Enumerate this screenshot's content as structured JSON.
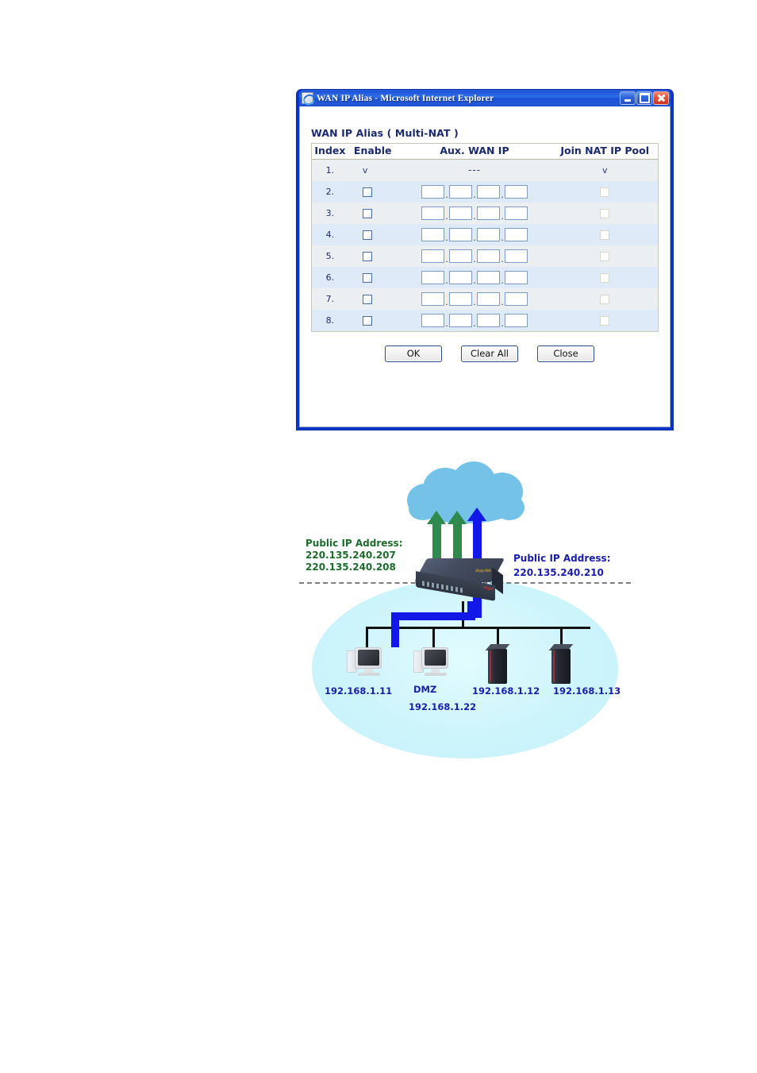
{
  "window": {
    "title": "WAN IP Alias - Microsoft Internet Explorer",
    "icon": "ie-page-icon",
    "minimize_label": "Minimize",
    "maximize_label": "Maximize",
    "close_label": "Close"
  },
  "page": {
    "heading": "WAN IP Alias ( Multi-NAT )",
    "columns": [
      "Index",
      "Enable",
      "Aux. WAN IP",
      "Join NAT IP Pool"
    ],
    "rows": [
      {
        "index": "1.",
        "enable": "v",
        "ip": "---",
        "pool": "v",
        "editable": false
      },
      {
        "index": "2.",
        "enable": "",
        "ip": [
          "",
          "",
          "",
          ""
        ],
        "pool": "",
        "editable": true
      },
      {
        "index": "3.",
        "enable": "",
        "ip": [
          "",
          "",
          "",
          ""
        ],
        "pool": "",
        "editable": true
      },
      {
        "index": "4.",
        "enable": "",
        "ip": [
          "",
          "",
          "",
          ""
        ],
        "pool": "",
        "editable": true
      },
      {
        "index": "5.",
        "enable": "",
        "ip": [
          "",
          "",
          "",
          ""
        ],
        "pool": "",
        "editable": true
      },
      {
        "index": "6.",
        "enable": "",
        "ip": [
          "",
          "",
          "",
          ""
        ],
        "pool": "",
        "editable": true
      },
      {
        "index": "7.",
        "enable": "",
        "ip": [
          "",
          "",
          "",
          ""
        ],
        "pool": "",
        "editable": true
      },
      {
        "index": "8.",
        "enable": "",
        "ip": [
          "",
          "",
          "",
          ""
        ],
        "pool": "",
        "editable": true
      }
    ],
    "octet_separator": ".",
    "buttons": {
      "ok": "OK",
      "clear_all": "Clear All",
      "close": "Close"
    }
  },
  "diagram": {
    "cloud_label": "Internet",
    "wan_left_title": "Public IP Address:",
    "wan_left_ip1": "220.135.240.207",
    "wan_left_ip2": "220.135.240.208",
    "wan_right_title": "Public IP Address:",
    "wan_right_ip": "220.135.240.210",
    "host1_label": "192.168.1.11",
    "host2_label": "DMZ",
    "host2_ip": "192.168.1.22",
    "host3_label": "192.168.1.12",
    "host4_label": "192.168.1.13"
  },
  "colors": {
    "titlebar_blue": "#1e52d8",
    "window_border": "#0a35c8",
    "heading_navy": "#1b2a6b",
    "row_odd": "#eceff1",
    "row_even": "#dfeaf8",
    "cloud_blue": "#74c2e8",
    "lan_cyan": "#cdf4fb",
    "arrow_green": "#2f8a4d",
    "arrow_blue": "#1219e6",
    "label_green": "#1d6b2c",
    "label_blue": "#1a1ea8"
  }
}
